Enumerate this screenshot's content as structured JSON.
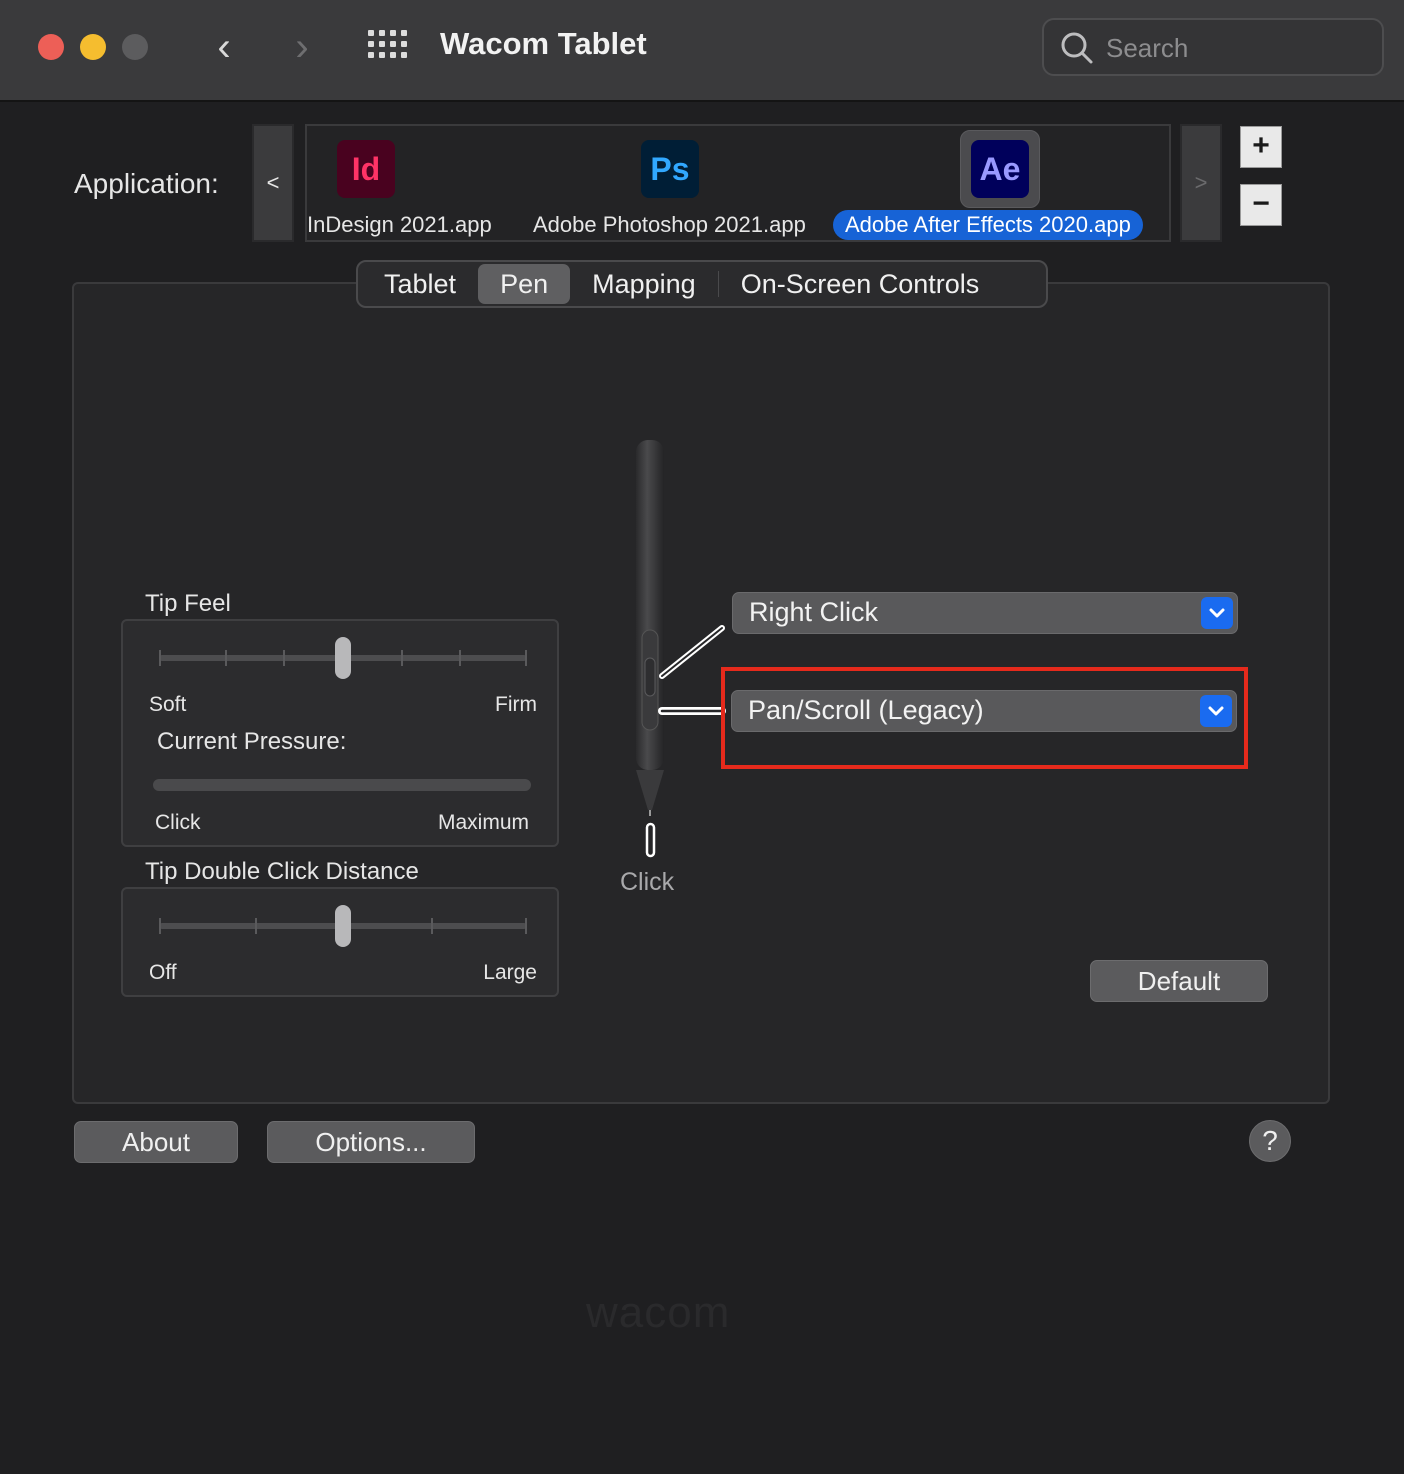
{
  "window": {
    "title": "Wacom Tablet",
    "search_placeholder": "Search"
  },
  "application": {
    "label": "Application:",
    "scroll_left": "<",
    "scroll_right": ">",
    "apps": [
      {
        "icon_text": "Id",
        "name": "InDesign 2021.app",
        "icon_bg": "#49021f",
        "icon_fg": "#ff3366",
        "selected": false
      },
      {
        "icon_text": "Ps",
        "name": "Adobe Photoshop 2021.app",
        "icon_bg": "#001e36",
        "icon_fg": "#31a8ff",
        "selected": false
      },
      {
        "icon_text": "Ae",
        "name": "Adobe After Effects 2020.app",
        "icon_bg": "#00005b",
        "icon_fg": "#9999ff",
        "selected": true
      }
    ],
    "add_label": "+",
    "remove_label": "−"
  },
  "tabs": [
    {
      "label": "Tablet",
      "active": false
    },
    {
      "label": "Pen",
      "active": true
    },
    {
      "label": "Mapping",
      "active": false
    },
    {
      "label": "On-Screen Controls",
      "active": false
    }
  ],
  "tip_feel": {
    "title": "Tip Feel",
    "min_label": "Soft",
    "max_label": "Firm",
    "value": 0.5,
    "current_pressure_label": "Current Pressure:",
    "pressure_value": 0,
    "pressure_min_label": "Click",
    "pressure_max_label": "Maximum"
  },
  "tip_double_click": {
    "title": "Tip Double Click Distance",
    "min_label": "Off",
    "max_label": "Large",
    "value": 0.5
  },
  "pen_buttons": {
    "upper": "Right Click",
    "lower": "Pan/Scroll (Legacy)",
    "tip_label": "Click"
  },
  "buttons": {
    "default": "Default",
    "about": "About",
    "options": "Options...",
    "help": "?"
  },
  "brand": "wacom",
  "colors": {
    "accent": "#1763d6",
    "highlight": "#e62a1c",
    "dropdown_arrow": "#1a6bf0"
  }
}
